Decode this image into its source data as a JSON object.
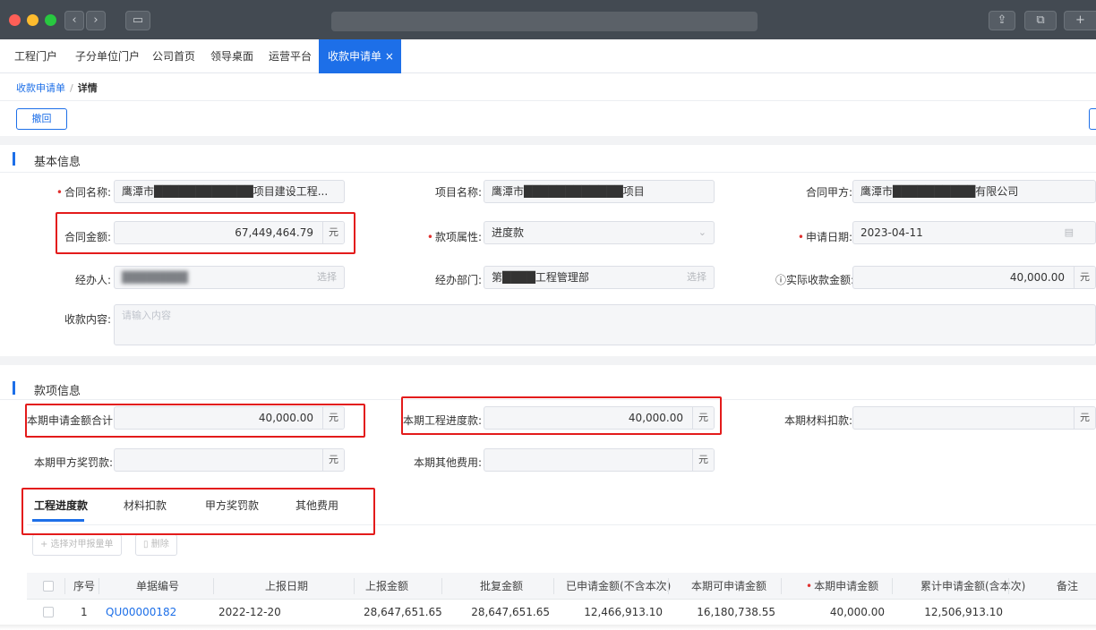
{
  "browser": {
    "colors": {
      "close": "#fe5f57",
      "min": "#febc2e",
      "max": "#28c840"
    }
  },
  "tabs": [
    "工程门户",
    "子分单位门户",
    "公司首页",
    "领导桌面",
    "运营平台"
  ],
  "active_tab": {
    "label": "收款申请单",
    "close": "×"
  },
  "breadcrumb": {
    "parent": "收款申请单",
    "sep": "/",
    "current": "详情"
  },
  "back_button": "撤回",
  "sections": {
    "basic": "基本信息",
    "payment": "款项信息"
  },
  "basic": {
    "contract_name_label": "合同名称:",
    "contract_name": "鹰潭市████████████项目建设工程...",
    "project_name_label": "项目名称:",
    "project_name": "鹰潭市████████████项目",
    "party_a_label": "合同甲方:",
    "party_a": "鹰潭市██████████有限公司",
    "amount_label": "合同金额:",
    "amount": "67,449,464.79",
    "type_label": "款项属性:",
    "type": "进度款",
    "date_label": "申请日期:",
    "date": "2023-04-11",
    "handler_label": "经办人:",
    "handler": "████████",
    "dept_label": "经办部门:",
    "dept": "第████工程管理部",
    "actual_label": "实际收款金额:",
    "actual": "40,000.00",
    "content_label": "收款内容:",
    "content_placeholder": "请输入内容",
    "select": "选择",
    "unit": "元"
  },
  "payment": {
    "total_label": "本期申请金额合计:",
    "total": "40,000.00",
    "progress_label": "本期工程进度款:",
    "progress": "40,000.00",
    "material_label": "本期材料扣款:",
    "reward_label": "本期甲方奖罚款:",
    "other_label": "本期其他费用:",
    "unit": "元"
  },
  "subtabs": [
    "工程进度款",
    "材料扣款",
    "甲方奖罚款",
    "其他费用"
  ],
  "table_buttons": {
    "add": "+ 选择对甲报量单",
    "delete": "删除"
  },
  "table": {
    "headers": [
      "序号",
      "单据编号",
      "上报日期",
      "上报金额",
      "批复金额",
      "已申请金额(不含本次)",
      "本期可申请金额",
      "本期申请金额",
      "累计申请金额(含本次)",
      "备注"
    ],
    "rows": [
      [
        "1",
        "QU00000182",
        "2022-12-20",
        "28,647,651.65",
        "28,647,651.65",
        "12,466,913.10",
        "16,180,738.55",
        "40,000.00",
        "12,506,913.10",
        ""
      ]
    ]
  }
}
